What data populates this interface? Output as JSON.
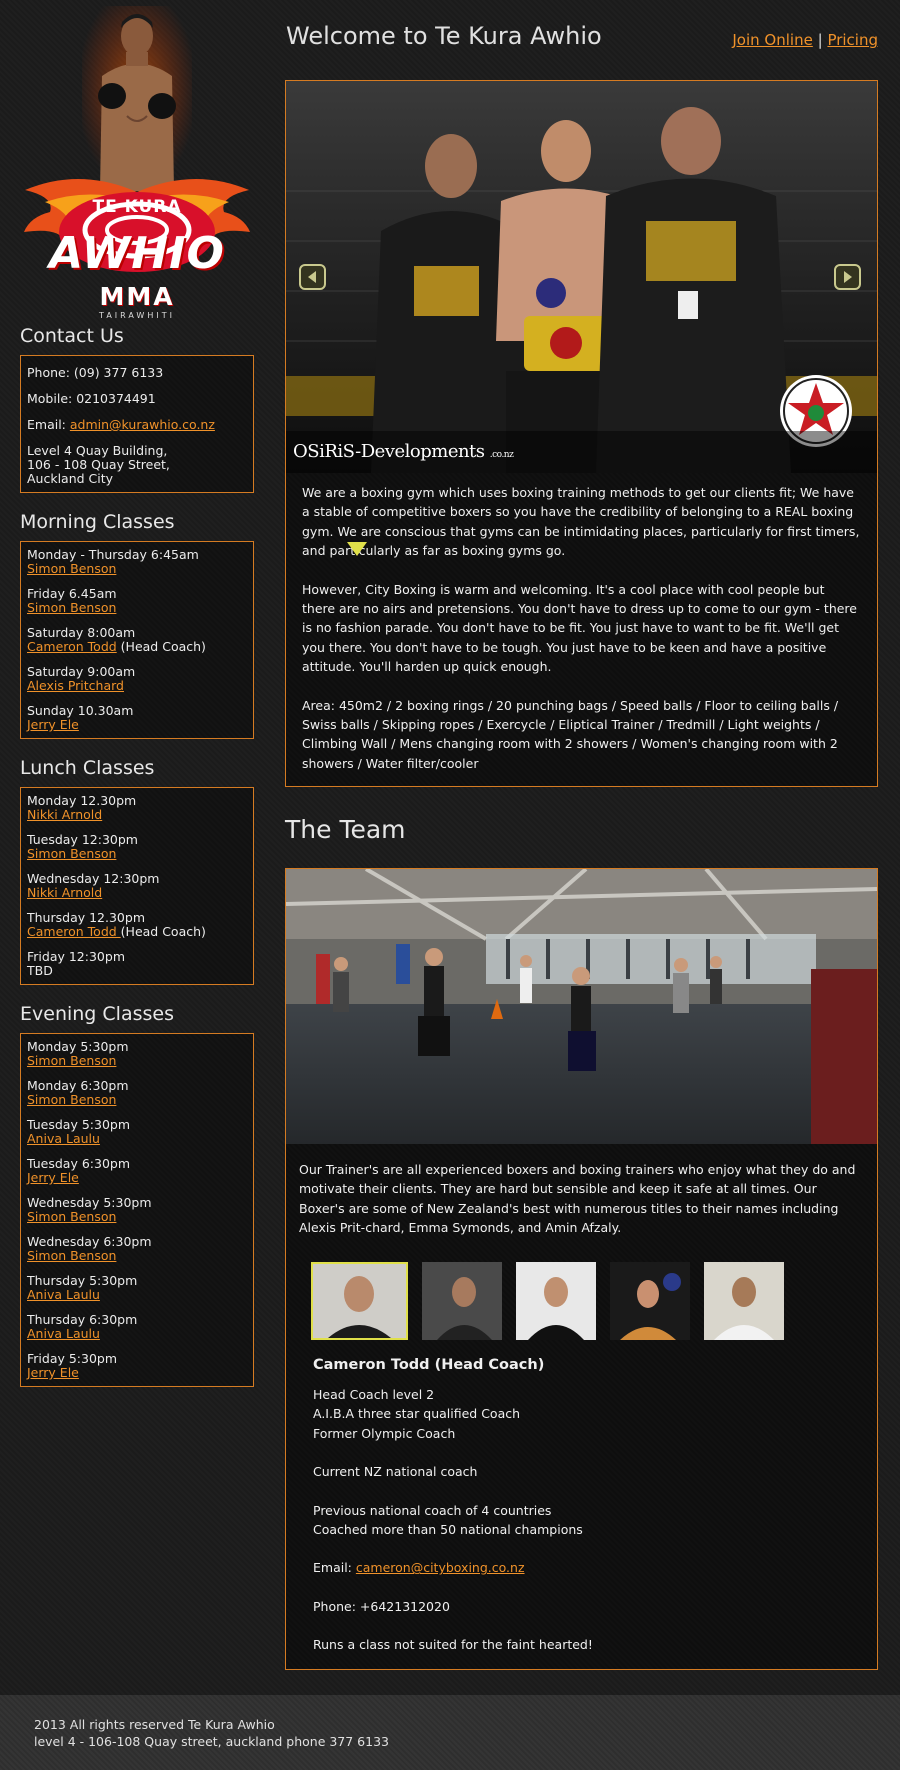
{
  "logo": {
    "top": "TE KURA",
    "main": "AWHIO",
    "sub": "MMA",
    "tag": "TAIRAWHITI"
  },
  "contact": {
    "heading": "Contact Us",
    "phone": "Phone: (09) 377 6133",
    "mobile": "Mobile: 0210374491",
    "email_label": "Email: ",
    "email": "admin@kurawhio.co.nz",
    "address_1": "Level 4 Quay Building,",
    "address_2": "106 - 108 Quay Street,",
    "address_3": "Auckland City"
  },
  "morning": {
    "heading": "Morning Classes",
    "items": [
      {
        "time": "Monday - Thursday 6:45am",
        "trainer": "Simon Benson",
        "note": ""
      },
      {
        "time": "Friday 6.45am",
        "trainer": "Simon Benson",
        "note": ""
      },
      {
        "time": "Saturday 8:00am",
        "trainer": "Cameron Todd",
        "note": " (Head Coach)"
      },
      {
        "time": "Saturday 9:00am",
        "trainer": "Alexis Pritchard",
        "note": ""
      },
      {
        "time": "Sunday 10.30am",
        "trainer": "Jerry Ele",
        "note": ""
      }
    ]
  },
  "lunch": {
    "heading": "Lunch Classes",
    "items": [
      {
        "time": "Monday 12.30pm",
        "trainer": "Nikki Arnold",
        "note": ""
      },
      {
        "time": "Tuesday 12:30pm",
        "trainer": "Simon Benson",
        "note": ""
      },
      {
        "time": "Wednesday 12:30pm",
        "trainer": "Nikki Arnold",
        "note": ""
      },
      {
        "time": "Thursday 12.30pm",
        "trainer": "Cameron Todd ",
        "note": "(Head Coach)"
      },
      {
        "time": "Friday 12:30pm",
        "plain": "TBD"
      }
    ]
  },
  "evening": {
    "heading": "Evening Classes",
    "items": [
      {
        "time": "Monday 5:30pm",
        "trainer": "Simon Benson"
      },
      {
        "time": "Monday 6:30pm",
        "trainer": "Simon Benson"
      },
      {
        "time": "Tuesday 5:30pm",
        "trainer": "Aniva Laulu"
      },
      {
        "time": "Tuesday 6:30pm",
        "trainer": "Jerry Ele"
      },
      {
        "time": "Wednesday 5:30pm",
        "trainer": "Simon Benson"
      },
      {
        "time": "Wednesday 6:30pm",
        "trainer": "Simon Benson"
      },
      {
        "time": "Thursday 5:30pm",
        "trainer": "Aniva Laulu"
      },
      {
        "time": "Thursday 6:30pm",
        "trainer": "Aniva Laulu"
      },
      {
        "time": "Friday 5:30pm",
        "trainer": "Jerry Ele "
      }
    ]
  },
  "header": {
    "title": "Welcome to Te Kura Awhio",
    "join_link": "Join Online",
    "separator": "|",
    "pricing_link": "Pricing"
  },
  "slider": {
    "watermark": "OSiRiS-Developments",
    "watermark_sub": ".co.nz",
    "prev_icon": "arrow-left-icon",
    "next_icon": "arrow-right-icon"
  },
  "intro": {
    "p1": "We are a boxing gym which uses boxing training methods to get our clients fit; We have a stable of competitive boxers so you have the credibility of belonging to a REAL boxing gym. We are conscious that gyms can be intimidating places, particularly for first timers, and particularly as far as boxing gyms go.",
    "p2": "However, City Boxing is warm and welcoming. It's a cool place with cool people but there are no airs and pretensions. You don't have to dress up to come to our gym - there is no fashion parade. You don't have to be fit. You just have to want to be fit. We'll get you there. You don't have to be tough. You just have to be keen and have a positive attitude. You'll harden up quick enough.",
    "p3": "Area: 450m2 / 2 boxing rings / 20 punching bags / Speed balls / Floor to ceiling balls / Swiss balls / Skipping ropes / Exercycle / Eliptical Trainer / Tredmill / Light weights / Climbing Wall / Mens changing room with 2 showers / Women's changing room with 2 showers / Water filter/cooler"
  },
  "team": {
    "title": "The Team",
    "text": "Our Trainer's are all experienced boxers and boxing trainers who enjoy what they do and motivate their clients. They are hard but sensible and keep it safe at all times. Our Boxer's are some of New Zealand's best with numerous titles to their names including Alexis Prit-chard, Emma Symonds, and Amin Afzaly."
  },
  "coach": {
    "name": "Cameron Todd (Head Coach)",
    "line1": "Head Coach level 2",
    "line2": "A.I.B.A three star qualified Coach",
    "line3": "Former Olympic Coach",
    "line4": "Current NZ national coach",
    "line5": "Previous national coach of 4 countries",
    "line6": "Coached more than 50 national champions",
    "email_label": "Email: ",
    "email": "cameron@cityboxing.co.nz",
    "phone": "Phone: +6421312020",
    "tagline": "Runs a class not suited for the faint hearted!"
  },
  "footer": {
    "line1": "2013 All rights reserved Te Kura Awhio",
    "line2": "level 4 - 106-108 Quay street, auckland phone 377 6133"
  },
  "colors": {
    "accent": "#f0922a",
    "border": "#d57b22",
    "background": "#1b1b1b",
    "thumb_selected": "#e0e04a"
  }
}
